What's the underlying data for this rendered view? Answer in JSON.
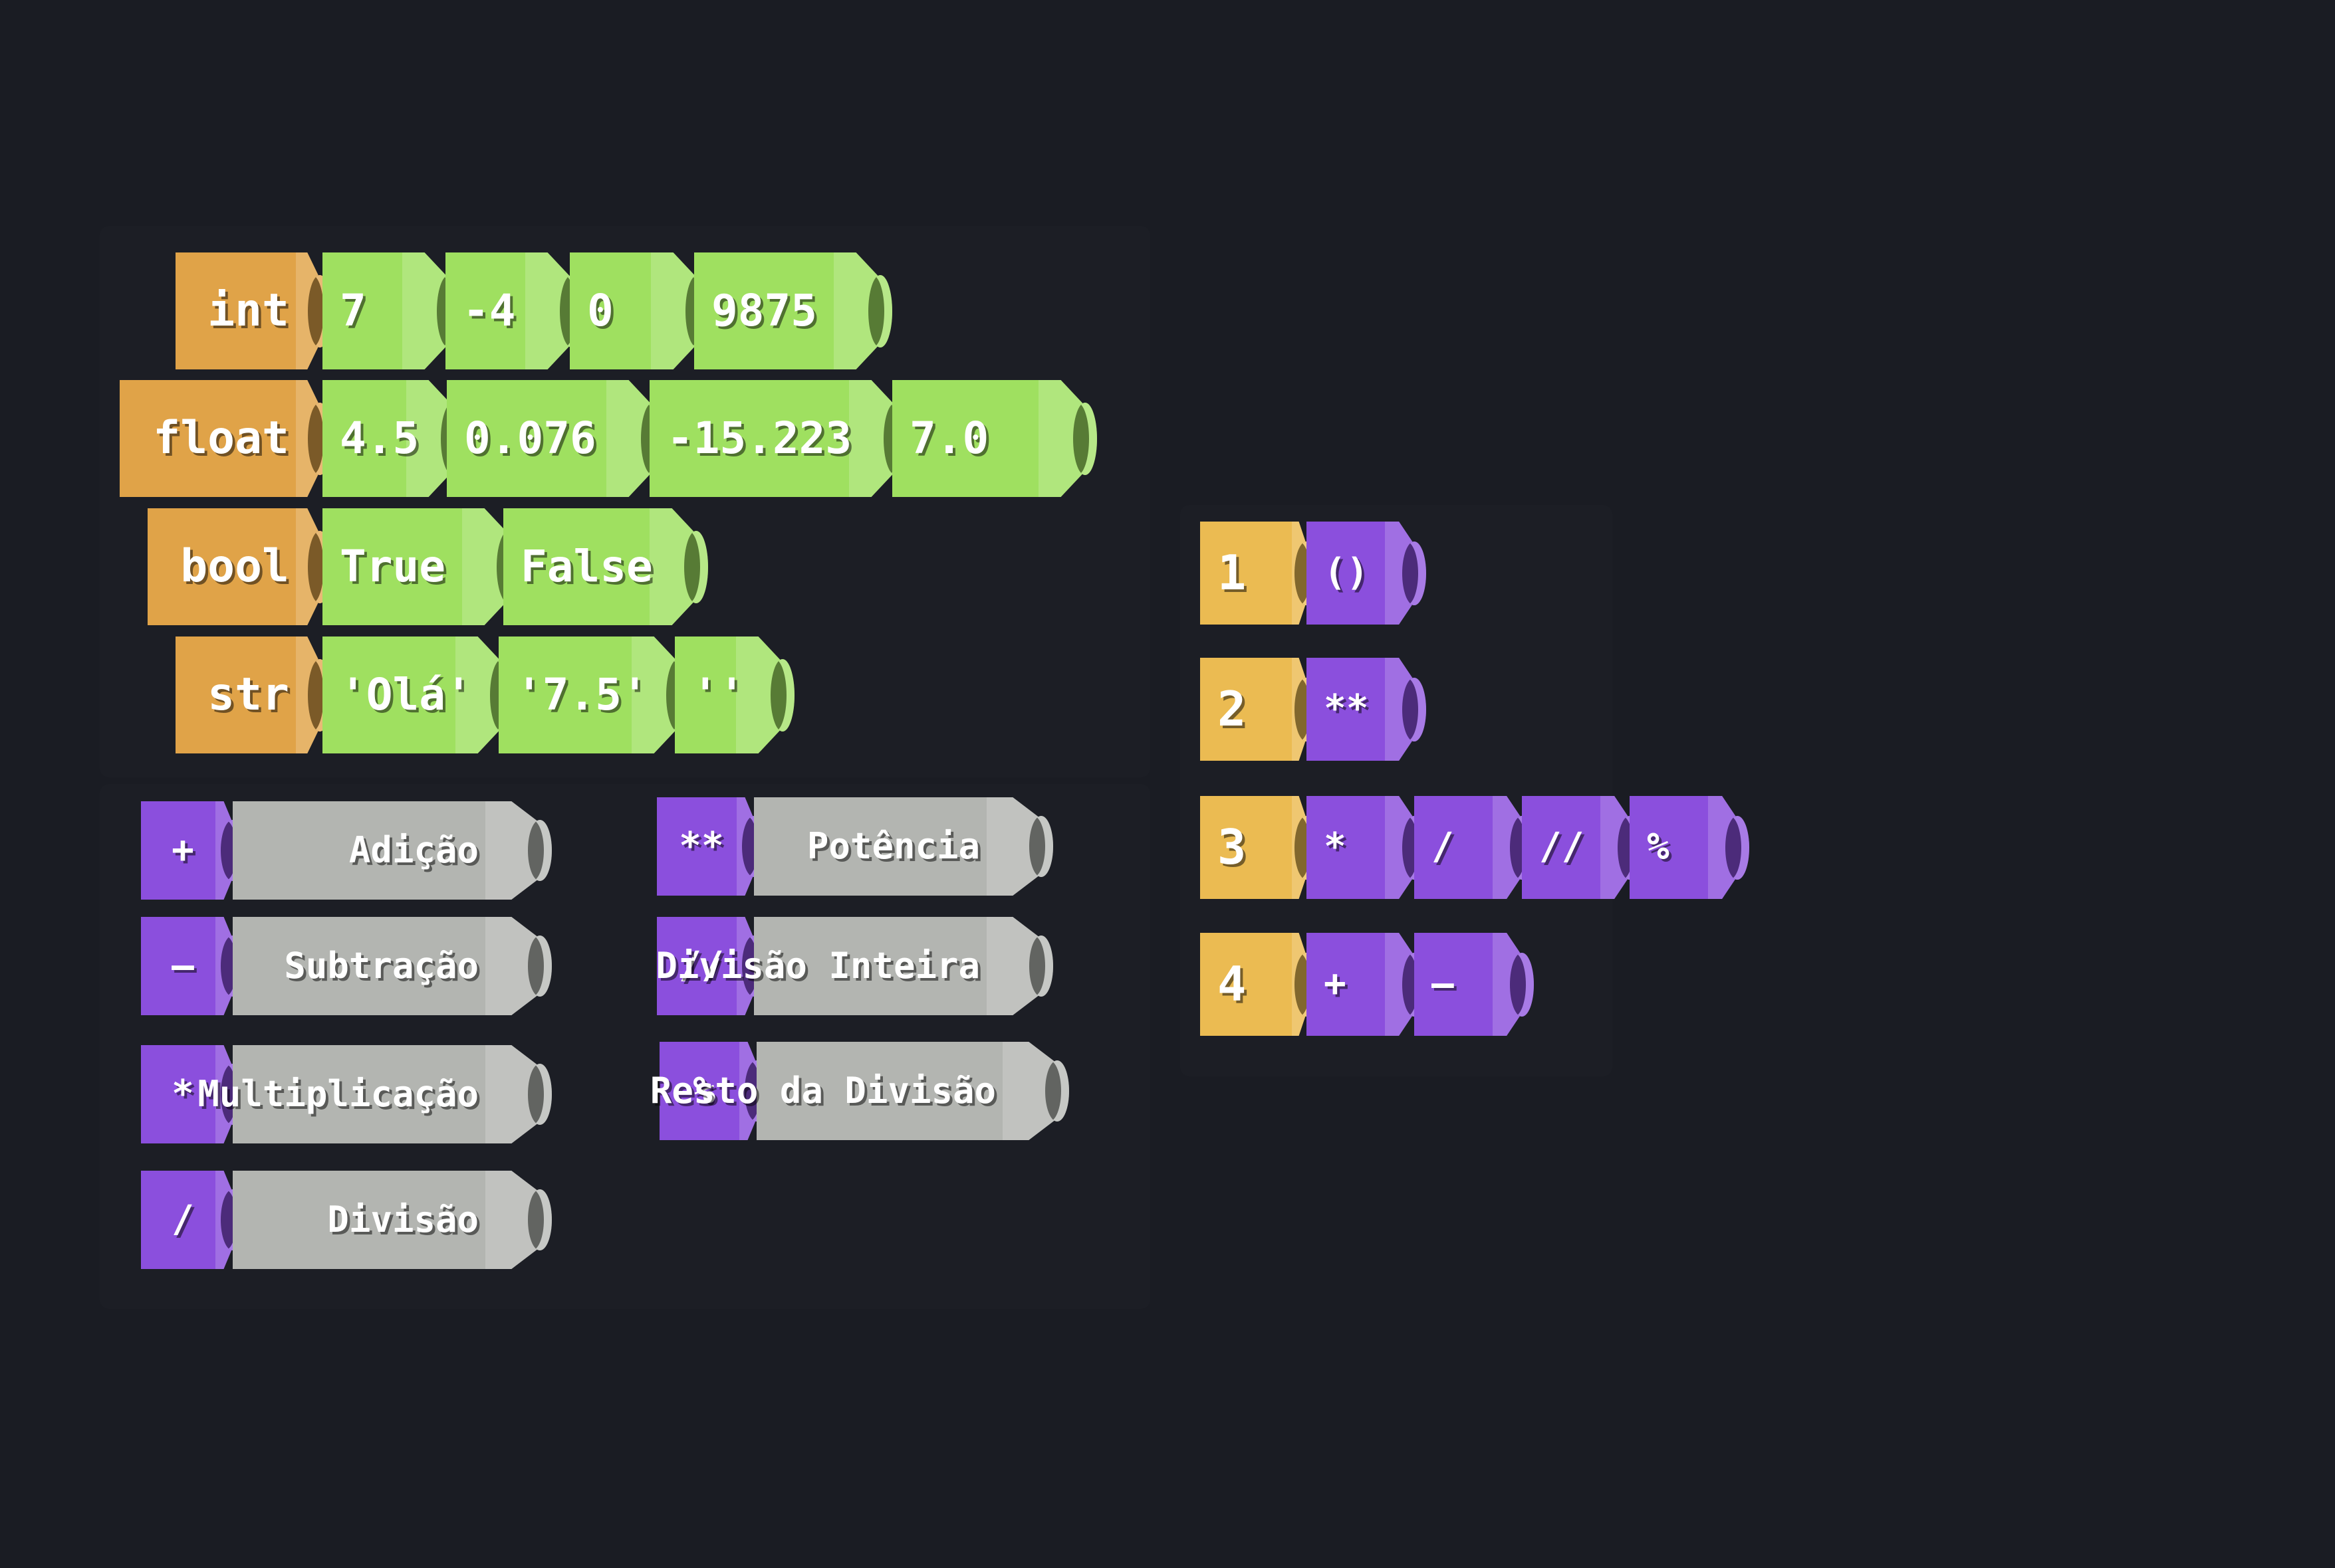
{
  "colors": {
    "background": "#1a1c23",
    "type_block": "#e0a348",
    "value_block": "#9fe060",
    "operator_block": "#8b4fdd",
    "label_block": "#b3b5b1",
    "precedence_block": "#ebbb52"
  },
  "types": [
    {
      "name": "int",
      "values": [
        "7",
        "-4",
        "0",
        "9875"
      ]
    },
    {
      "name": "float",
      "values": [
        "4.5",
        "0.076",
        "-15.223",
        "7.0"
      ]
    },
    {
      "name": "bool",
      "values": [
        "True",
        "False"
      ]
    },
    {
      "name": "str",
      "values": [
        "'Olá'",
        "'7.5'",
        "''"
      ]
    }
  ],
  "operators": [
    {
      "symbol": "+",
      "name": "Adição"
    },
    {
      "symbol": "-",
      "name": "Subtração"
    },
    {
      "symbol": "*",
      "name": "Multiplicação"
    },
    {
      "symbol": "/",
      "name": "Divisão"
    },
    {
      "symbol": "**",
      "name": "Potência"
    },
    {
      "symbol": "//",
      "name": "Divisão Inteira"
    },
    {
      "symbol": "%",
      "name": "Resto da Divisão"
    }
  ],
  "precedence": [
    {
      "level": "1",
      "ops": [
        "()"
      ]
    },
    {
      "level": "2",
      "ops": [
        "**"
      ]
    },
    {
      "level": "3",
      "ops": [
        "*",
        "/",
        "//",
        "%"
      ]
    },
    {
      "level": "4",
      "ops": [
        "+",
        "-"
      ]
    }
  ]
}
